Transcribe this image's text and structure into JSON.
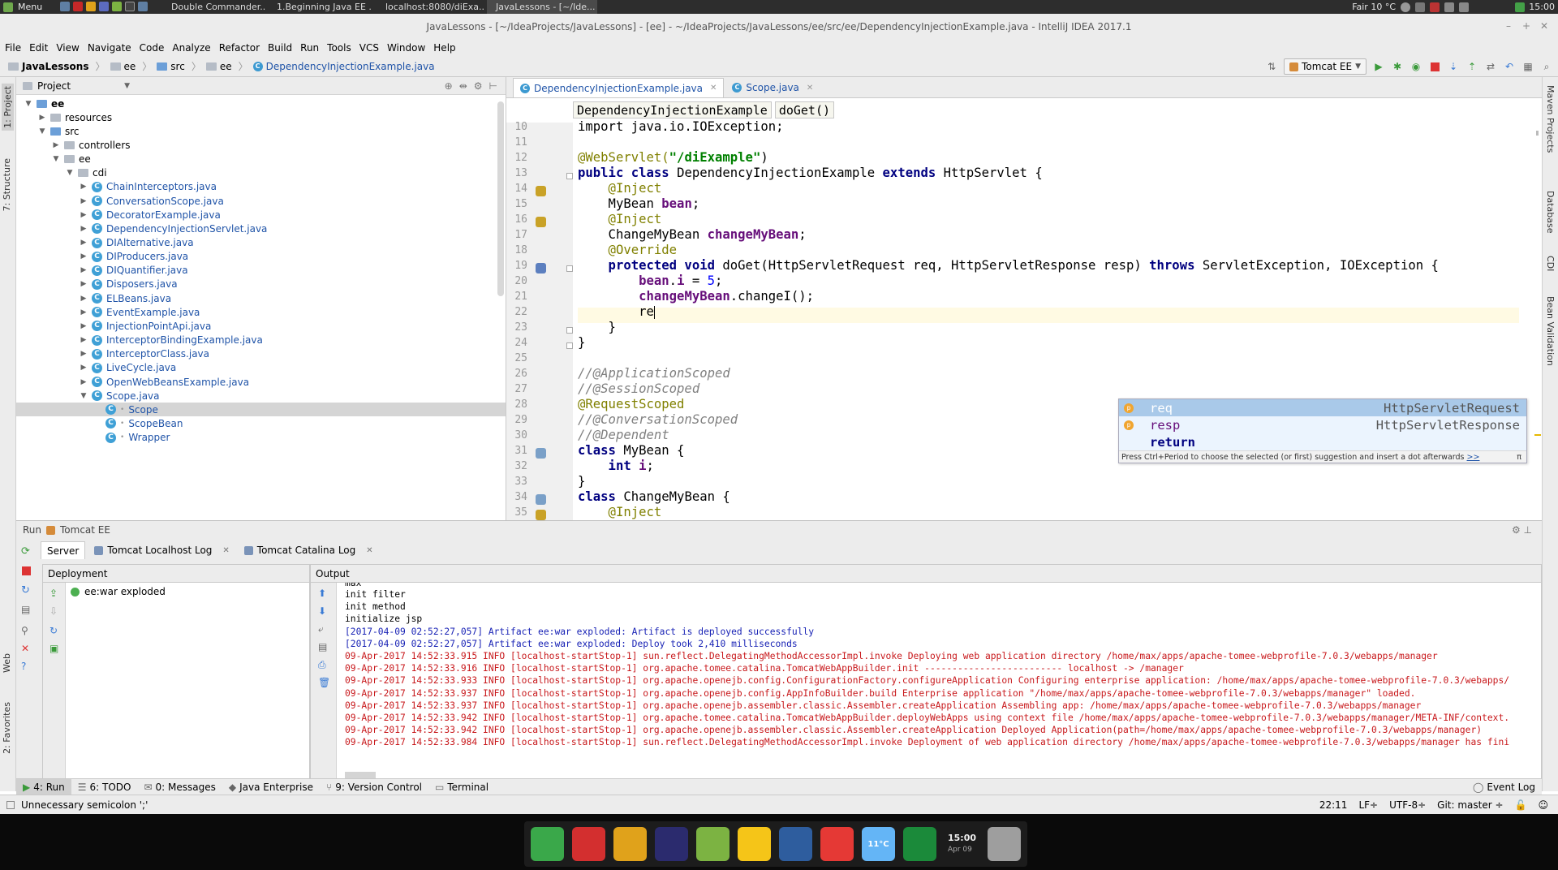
{
  "system_panel": {
    "menu_label": "Menu",
    "tasks": [
      {
        "label": "Double Commander...",
        "color": "#c62828"
      },
      {
        "label": "1.Beginning Java EE ...",
        "color": "#7e57c2"
      },
      {
        "label": "localhost:8080/diExa...",
        "color": "#43a047"
      },
      {
        "label": "JavaLessons - [~/Ide...",
        "color": "#5c6bc0"
      }
    ],
    "weather": "Fair 10 °C",
    "clock": "15:00"
  },
  "window": {
    "title": "JavaLessons - [~/IdeaProjects/JavaLessons] - [ee] - ~/IdeaProjects/JavaLessons/ee/src/ee/DependencyInjectionExample.java - IntelliJ IDEA 2017.1"
  },
  "menubar": [
    "File",
    "Edit",
    "View",
    "Navigate",
    "Code",
    "Analyze",
    "Refactor",
    "Build",
    "Run",
    "Tools",
    "VCS",
    "Window",
    "Help"
  ],
  "navbar": {
    "crumbs": [
      "JavaLessons",
      "ee",
      "src",
      "ee",
      "DependencyInjectionExample.java"
    ],
    "run_config": "Tomcat EE"
  },
  "project_panel": {
    "title": "Project",
    "tree": [
      {
        "label": "ee",
        "indent": 0,
        "kind": "module",
        "expanded": true,
        "bold": true
      },
      {
        "label": "resources",
        "indent": 1,
        "kind": "folder",
        "expanded": false
      },
      {
        "label": "src",
        "indent": 1,
        "kind": "srcfolder",
        "expanded": true
      },
      {
        "label": "controllers",
        "indent": 2,
        "kind": "folder",
        "expanded": false
      },
      {
        "label": "ee",
        "indent": 2,
        "kind": "folder",
        "expanded": true
      },
      {
        "label": "cdi",
        "indent": 3,
        "kind": "folder",
        "expanded": true
      },
      {
        "label": "ChainInterceptors.java",
        "indent": 4,
        "kind": "java"
      },
      {
        "label": "ConversationScope.java",
        "indent": 4,
        "kind": "java"
      },
      {
        "label": "DecoratorExample.java",
        "indent": 4,
        "kind": "java"
      },
      {
        "label": "DependencyInjectionServlet.java",
        "indent": 4,
        "kind": "java"
      },
      {
        "label": "DIAlternative.java",
        "indent": 4,
        "kind": "java"
      },
      {
        "label": "DIProducers.java",
        "indent": 4,
        "kind": "java"
      },
      {
        "label": "DIQuantifier.java",
        "indent": 4,
        "kind": "java"
      },
      {
        "label": "Disposers.java",
        "indent": 4,
        "kind": "java"
      },
      {
        "label": "ELBeans.java",
        "indent": 4,
        "kind": "java"
      },
      {
        "label": "EventExample.java",
        "indent": 4,
        "kind": "java"
      },
      {
        "label": "InjectionPointApi.java",
        "indent": 4,
        "kind": "java"
      },
      {
        "label": "InterceptorBindingExample.java",
        "indent": 4,
        "kind": "java"
      },
      {
        "label": "InterceptorClass.java",
        "indent": 4,
        "kind": "java"
      },
      {
        "label": "LiveCycle.java",
        "indent": 4,
        "kind": "java"
      },
      {
        "label": "OpenWebBeansExample.java",
        "indent": 4,
        "kind": "java"
      },
      {
        "label": "Scope.java",
        "indent": 4,
        "kind": "java",
        "expanded": true
      },
      {
        "label": "Scope",
        "indent": 5,
        "kind": "class",
        "selected": true
      },
      {
        "label": "ScopeBean",
        "indent": 5,
        "kind": "class"
      },
      {
        "label": "Wrapper",
        "indent": 5,
        "kind": "class"
      }
    ]
  },
  "editor": {
    "tabs": [
      {
        "label": "DependencyInjectionExample.java",
        "active": true
      },
      {
        "label": "Scope.java",
        "active": false
      }
    ],
    "breadcrumbs": [
      "DependencyInjectionExample",
      "doGet()"
    ],
    "line_numbers": [
      "10",
      "11",
      "12",
      "13",
      "14",
      "15",
      "16",
      "17",
      "18",
      "19",
      "20",
      "21",
      "22",
      "23",
      "24",
      "25",
      "26",
      "27",
      "28",
      "29",
      "30",
      "31",
      "32",
      "33",
      "34",
      "35"
    ],
    "code_lines": [
      [
        {
          "t": "import java.io.IOException;",
          "c": ""
        }
      ],
      [],
      [
        {
          "t": "@WebServlet(",
          "c": "an"
        },
        {
          "t": "\"/diExample\"",
          "c": "st"
        },
        {
          "t": ")",
          "c": ""
        }
      ],
      [
        {
          "t": "public class ",
          "c": "kw"
        },
        {
          "t": "DependencyInjectionExample ",
          "c": ""
        },
        {
          "t": "extends ",
          "c": "kw"
        },
        {
          "t": "HttpServlet {",
          "c": ""
        }
      ],
      [
        {
          "t": "    @Inject",
          "c": "an"
        }
      ],
      [
        {
          "t": "    MyBean ",
          "c": ""
        },
        {
          "t": "bean",
          "c": "fd"
        },
        {
          "t": ";",
          "c": ""
        }
      ],
      [
        {
          "t": "    @Inject",
          "c": "an"
        }
      ],
      [
        {
          "t": "    ChangeMyBean ",
          "c": ""
        },
        {
          "t": "changeMyBean",
          "c": "fd"
        },
        {
          "t": ";",
          "c": ""
        }
      ],
      [
        {
          "t": "    @Override",
          "c": "an"
        }
      ],
      [
        {
          "t": "    protected void ",
          "c": "kw"
        },
        {
          "t": "doGet(HttpServletRequest req, HttpServletResponse resp) ",
          "c": ""
        },
        {
          "t": "throws ",
          "c": "kw"
        },
        {
          "t": "ServletException, IOException {",
          "c": ""
        }
      ],
      [
        {
          "t": "        ",
          "c": ""
        },
        {
          "t": "bean",
          "c": "fd"
        },
        {
          "t": ".",
          "c": ""
        },
        {
          "t": "i",
          "c": "fd"
        },
        {
          "t": " = ",
          "c": ""
        },
        {
          "t": "5",
          "c": "nm"
        },
        {
          "t": ";",
          "c": ""
        }
      ],
      [
        {
          "t": "        ",
          "c": ""
        },
        {
          "t": "changeMyBean",
          "c": "fd"
        },
        {
          "t": ".changeI();",
          "c": ""
        }
      ],
      [
        {
          "t": "        re",
          "c": ""
        }
      ],
      [
        {
          "t": "    }",
          "c": ""
        }
      ],
      [
        {
          "t": "}",
          "c": ""
        }
      ],
      [],
      [
        {
          "t": "//@ApplicationScoped",
          "c": "cm"
        }
      ],
      [
        {
          "t": "//@SessionScoped",
          "c": "cm"
        }
      ],
      [
        {
          "t": "@RequestScoped",
          "c": "an"
        }
      ],
      [
        {
          "t": "//@ConversationScoped",
          "c": "cm"
        }
      ],
      [
        {
          "t": "//@Dependent",
          "c": "cm"
        }
      ],
      [
        {
          "t": "class ",
          "c": "kw"
        },
        {
          "t": "MyBean {",
          "c": ""
        }
      ],
      [
        {
          "t": "    int ",
          "c": "kw"
        },
        {
          "t": "i",
          "c": "fd"
        },
        {
          "t": ";",
          "c": ""
        }
      ],
      [
        {
          "t": "}",
          "c": ""
        }
      ],
      [
        {
          "t": "class ",
          "c": "kw"
        },
        {
          "t": "ChangeMyBean {",
          "c": ""
        }
      ],
      [
        {
          "t": "    @Inject",
          "c": "an"
        }
      ]
    ],
    "completion": {
      "items": [
        {
          "name": "req",
          "type": "HttpServletRequest",
          "selected": true,
          "icon": "p"
        },
        {
          "name": "resp",
          "type": "HttpServletResponse",
          "selected": false,
          "icon": "p"
        },
        {
          "name": "return",
          "type": "",
          "selected": false,
          "icon": ""
        }
      ],
      "hint": "Press Ctrl+Period to choose the selected (or first) suggestion and insert a dot afterwards",
      "hint_link": ">>"
    }
  },
  "run_panel": {
    "header": "Run",
    "config": "Tomcat EE",
    "tabs": [
      {
        "label": "Server",
        "active": true,
        "closable": false
      },
      {
        "label": "Tomcat Localhost Log",
        "active": false,
        "closable": true
      },
      {
        "label": "Tomcat Catalina Log",
        "active": false,
        "closable": true
      }
    ],
    "deployment_header": "Deployment",
    "deployment_item": "ee:war exploded",
    "output_header": "Output",
    "log_lines": [
      {
        "t": "max",
        "c": ""
      },
      {
        "t": "init filter",
        "c": ""
      },
      {
        "t": "init method",
        "c": ""
      },
      {
        "t": "initialize jsp",
        "c": ""
      },
      {
        "t": "[2017-04-09 02:52:27,057] Artifact ee:war exploded: Artifact is deployed successfully",
        "c": "blue"
      },
      {
        "t": "[2017-04-09 02:52:27,057] Artifact ee:war exploded: Deploy took 2,410 milliseconds",
        "c": "blue"
      },
      {
        "t": "09-Apr-2017 14:52:33.915 INFO [localhost-startStop-1] sun.reflect.DelegatingMethodAccessorImpl.invoke Deploying web application directory /home/max/apps/apache-tomee-webprofile-7.0.3/webapps/manager",
        "c": "red"
      },
      {
        "t": "09-Apr-2017 14:52:33.916 INFO [localhost-startStop-1] org.apache.tomee.catalina.TomcatWebAppBuilder.init ------------------------- localhost -> /manager",
        "c": "red"
      },
      {
        "t": "09-Apr-2017 14:52:33.933 INFO [localhost-startStop-1] org.apache.openejb.config.ConfigurationFactory.configureApplication Configuring enterprise application: /home/max/apps/apache-tomee-webprofile-7.0.3/webapps/",
        "c": "red"
      },
      {
        "t": "09-Apr-2017 14:52:33.937 INFO [localhost-startStop-1] org.apache.openejb.config.AppInfoBuilder.build Enterprise application \"/home/max/apps/apache-tomee-webprofile-7.0.3/webapps/manager\" loaded.",
        "c": "red"
      },
      {
        "t": "09-Apr-2017 14:52:33.937 INFO [localhost-startStop-1] org.apache.openejb.assembler.classic.Assembler.createApplication Assembling app: /home/max/apps/apache-tomee-webprofile-7.0.3/webapps/manager",
        "c": "red"
      },
      {
        "t": "09-Apr-2017 14:52:33.942 INFO [localhost-startStop-1] org.apache.tomee.catalina.TomcatWebAppBuilder.deployWebApps using context file /home/max/apps/apache-tomee-webprofile-7.0.3/webapps/manager/META-INF/context.",
        "c": "red"
      },
      {
        "t": "09-Apr-2017 14:52:33.942 INFO [localhost-startStop-1] org.apache.openejb.assembler.classic.Assembler.createApplication Deployed Application(path=/home/max/apps/apache-tomee-webprofile-7.0.3/webapps/manager)",
        "c": "red"
      },
      {
        "t": "09-Apr-2017 14:52:33.984 INFO [localhost-startStop-1] sun.reflect.DelegatingMethodAccessorImpl.invoke Deployment of web application directory /home/max/apps/apache-tomee-webprofile-7.0.3/webapps/manager has fini",
        "c": "red"
      }
    ]
  },
  "tool_tabs": [
    {
      "label": "4: Run",
      "active": true
    },
    {
      "label": "6: TODO",
      "active": false
    },
    {
      "label": "0: Messages",
      "active": false
    },
    {
      "label": "Java Enterprise",
      "active": false
    },
    {
      "label": "9: Version Control",
      "active": false
    },
    {
      "label": "Terminal",
      "active": false
    }
  ],
  "event_log": "Event Log",
  "left_strip": [
    "1: Project",
    "7: Structure",
    "Web",
    "2: Favorites"
  ],
  "right_strip": [
    "Maven Projects",
    "Database",
    "CDI",
    "Bean Validation"
  ],
  "status_bar": {
    "message": "Unnecessary semicolon ';'",
    "position": "22:11",
    "line_sep": "LF÷",
    "encoding": "UTF-8÷",
    "vcs": "Git: master ÷"
  },
  "dock": {
    "clock_time": "15:00",
    "clock_date": "Apr 09",
    "weather_temp": "11°C",
    "apps": [
      {
        "name": "anchor",
        "color": "#3aa84a"
      },
      {
        "name": "double-commander",
        "color": "#d32f2f"
      },
      {
        "name": "chrome",
        "color": "#e0a21b"
      },
      {
        "name": "intellij",
        "color": "#2b2b6e"
      },
      {
        "name": "spiral",
        "color": "#7cb342"
      },
      {
        "name": "files",
        "color": "#f5c518"
      },
      {
        "name": "media-player",
        "color": "#2e5d9e"
      },
      {
        "name": "pdf-reader",
        "color": "#e53935"
      },
      {
        "name": "weather",
        "color": "#64b5f6"
      },
      {
        "name": "radar",
        "color": "#1b8a3a"
      },
      {
        "name": "trash",
        "color": "#9e9e9e"
      }
    ]
  }
}
